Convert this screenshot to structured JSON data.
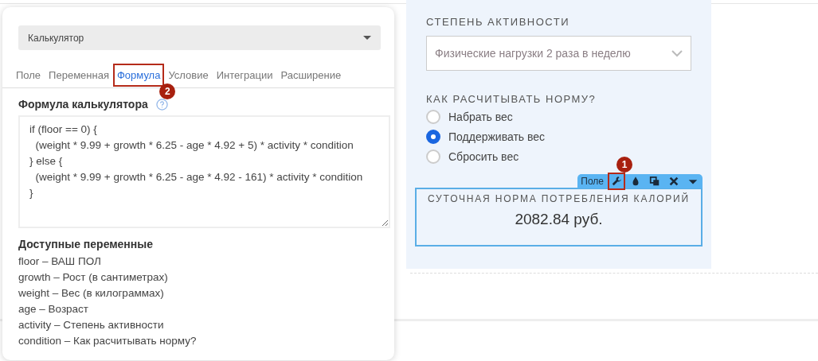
{
  "settings_panel": {
    "calculator_select": {
      "value": "Калькулятор"
    },
    "tabs": [
      {
        "label": "Поле",
        "selected": false
      },
      {
        "label": "Переменная",
        "selected": false
      },
      {
        "label": "Формула",
        "selected": true,
        "callout": "2"
      },
      {
        "label": "Условие",
        "selected": false
      },
      {
        "label": "Интеграции",
        "selected": false
      },
      {
        "label": "Расширение",
        "selected": false
      }
    ],
    "formula_title": "Формула калькулятора",
    "formula": "if (floor == 0) {\n  (weight * 9.99 + growth * 6.25 - age * 4.92 + 5) * activity * condition\n} else {\n  (weight * 9.99 + growth * 6.25 - age * 4.92 - 161) * activity * condition\n}",
    "variables_title": "Доступные переменные",
    "variables": [
      "floor – ВАШ ПОЛ",
      "growth – Рост (в сантиметрах)",
      "weight – Вес (в килограммах)",
      "age – Возраст",
      "activity – Степень активности",
      "condition – Как расчитывать норму?"
    ]
  },
  "form": {
    "activity_label": "СТЕПЕНЬ АКТИВНОСТИ",
    "activity_select": {
      "value": "Физические нагрузки 2 раза в неделю"
    },
    "norm_label": "КАК РАСЧИТЫВАТЬ НОРМУ?",
    "norm_options": [
      {
        "label": "Набрать вес",
        "selected": false
      },
      {
        "label": "Поддерживать вес",
        "selected": true
      },
      {
        "label": "Сбросить вес",
        "selected": false
      }
    ],
    "result_field": {
      "toolbar": {
        "label": "Поле",
        "tools": [
          {
            "kind": "wrench",
            "callout": "1"
          },
          {
            "kind": "drop"
          },
          {
            "kind": "copy"
          },
          {
            "kind": "close"
          },
          {
            "kind": "caret"
          }
        ]
      },
      "label": "СУТОЧНАЯ НОРМА ПОТРЕБЛЕНИЯ КАЛОРИЙ",
      "value": "2082.84 руб."
    }
  }
}
